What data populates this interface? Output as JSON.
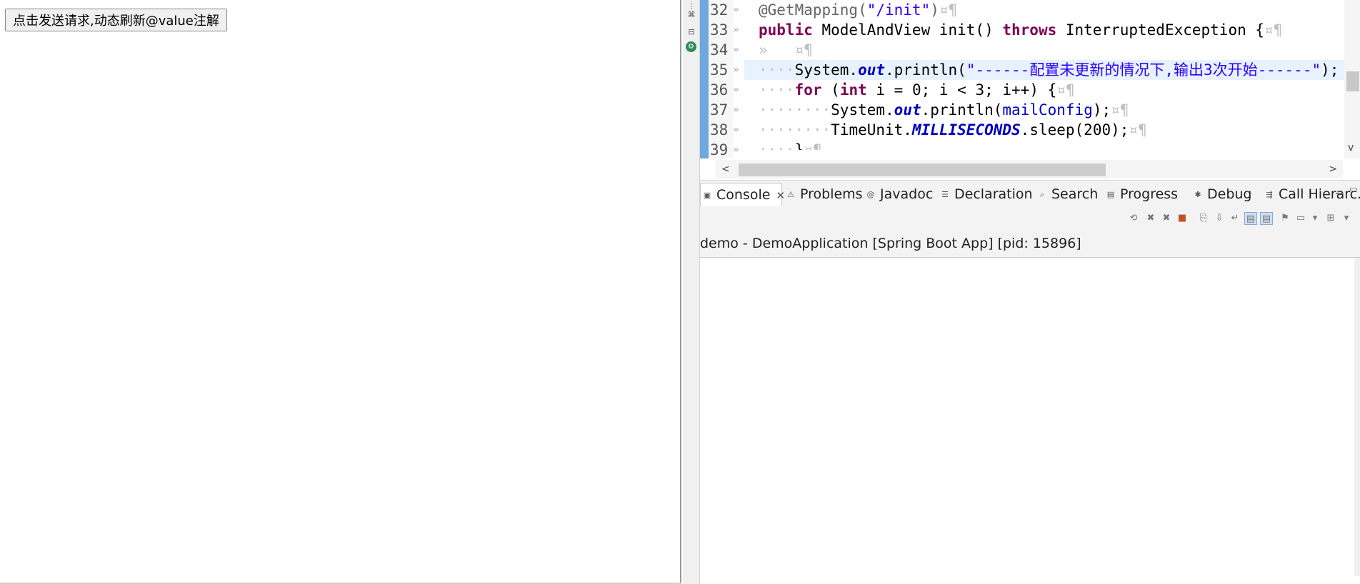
{
  "browser": {
    "refresh_button_label": "点击发送请求,动态刷新@value注解"
  },
  "editor": {
    "line_numbers": [
      "32",
      "33",
      "34",
      "35",
      "36",
      "37",
      "38",
      "39"
    ],
    "fold_marker": "»",
    "lines": {
      "l32_annotation": "@GetMapping(",
      "l32_string": "\"/init\"",
      "l32_close": ")",
      "l32_ws": "¤¶",
      "l33_public": "public",
      "l33_sig": " ModelAndView init() ",
      "l33_throws": "throws",
      "l33_rest": " InterruptedException {",
      "l33_ws": "¤¶",
      "l34_ws": "»   ¤¶",
      "l35_indent": "····",
      "l35_sys": "System.",
      "l35_out": "out",
      "l35_println": ".println(",
      "l35_string": "\"------配置未更新的情况下,输出3次开始------\"",
      "l35_end": ");",
      "l36_indent": "····",
      "l36_for": "for",
      "l36_open": " (",
      "l36_int": "int",
      "l36_rest": " i = 0; i < 3; i++) {",
      "l36_ws": "¤¶",
      "l37_indent": "········",
      "l37_sys": "System.",
      "l37_out": "out",
      "l37_println": ".println(",
      "l37_var": "mailConfig",
      "l37_end": ");",
      "l37_ws": "¤¶",
      "l38_indent": "········",
      "l38_tu": "TimeUnit.",
      "l38_ms": "MILLISECONDS",
      "l38_sleep": ".sleep(200);",
      "l38_ws": "¤¶",
      "l39_indent": "····",
      "l39_brace": "}",
      "l39_ws": "¤¶"
    },
    "scroll_left": "<",
    "scroll_right": ">",
    "scroll_down": "v"
  },
  "views": {
    "tabs": [
      {
        "label": "Console",
        "icon": "console-icon"
      },
      {
        "label": "Problems",
        "icon": "problems-icon"
      },
      {
        "label": "Javadoc",
        "icon": "javadoc-icon"
      },
      {
        "label": "Declaration",
        "icon": "declaration-icon"
      },
      {
        "label": "Search",
        "icon": "search-icon"
      },
      {
        "label": "Progress",
        "icon": "progress-icon"
      },
      {
        "label": "Debug",
        "icon": "debug-icon"
      },
      {
        "label": "Call Hierarc...",
        "icon": "call-hierarchy-icon"
      }
    ],
    "close_glyph": "✕"
  },
  "console": {
    "header": "demo - DemoApplication [Spring Boot App]  [pid: 15896]"
  },
  "colors": {
    "keyword": "#7f0055",
    "string": "#2a00ff",
    "field": "#0000c0",
    "current_line": "#e8f2fe",
    "change_bar": "#6fa8dc"
  }
}
